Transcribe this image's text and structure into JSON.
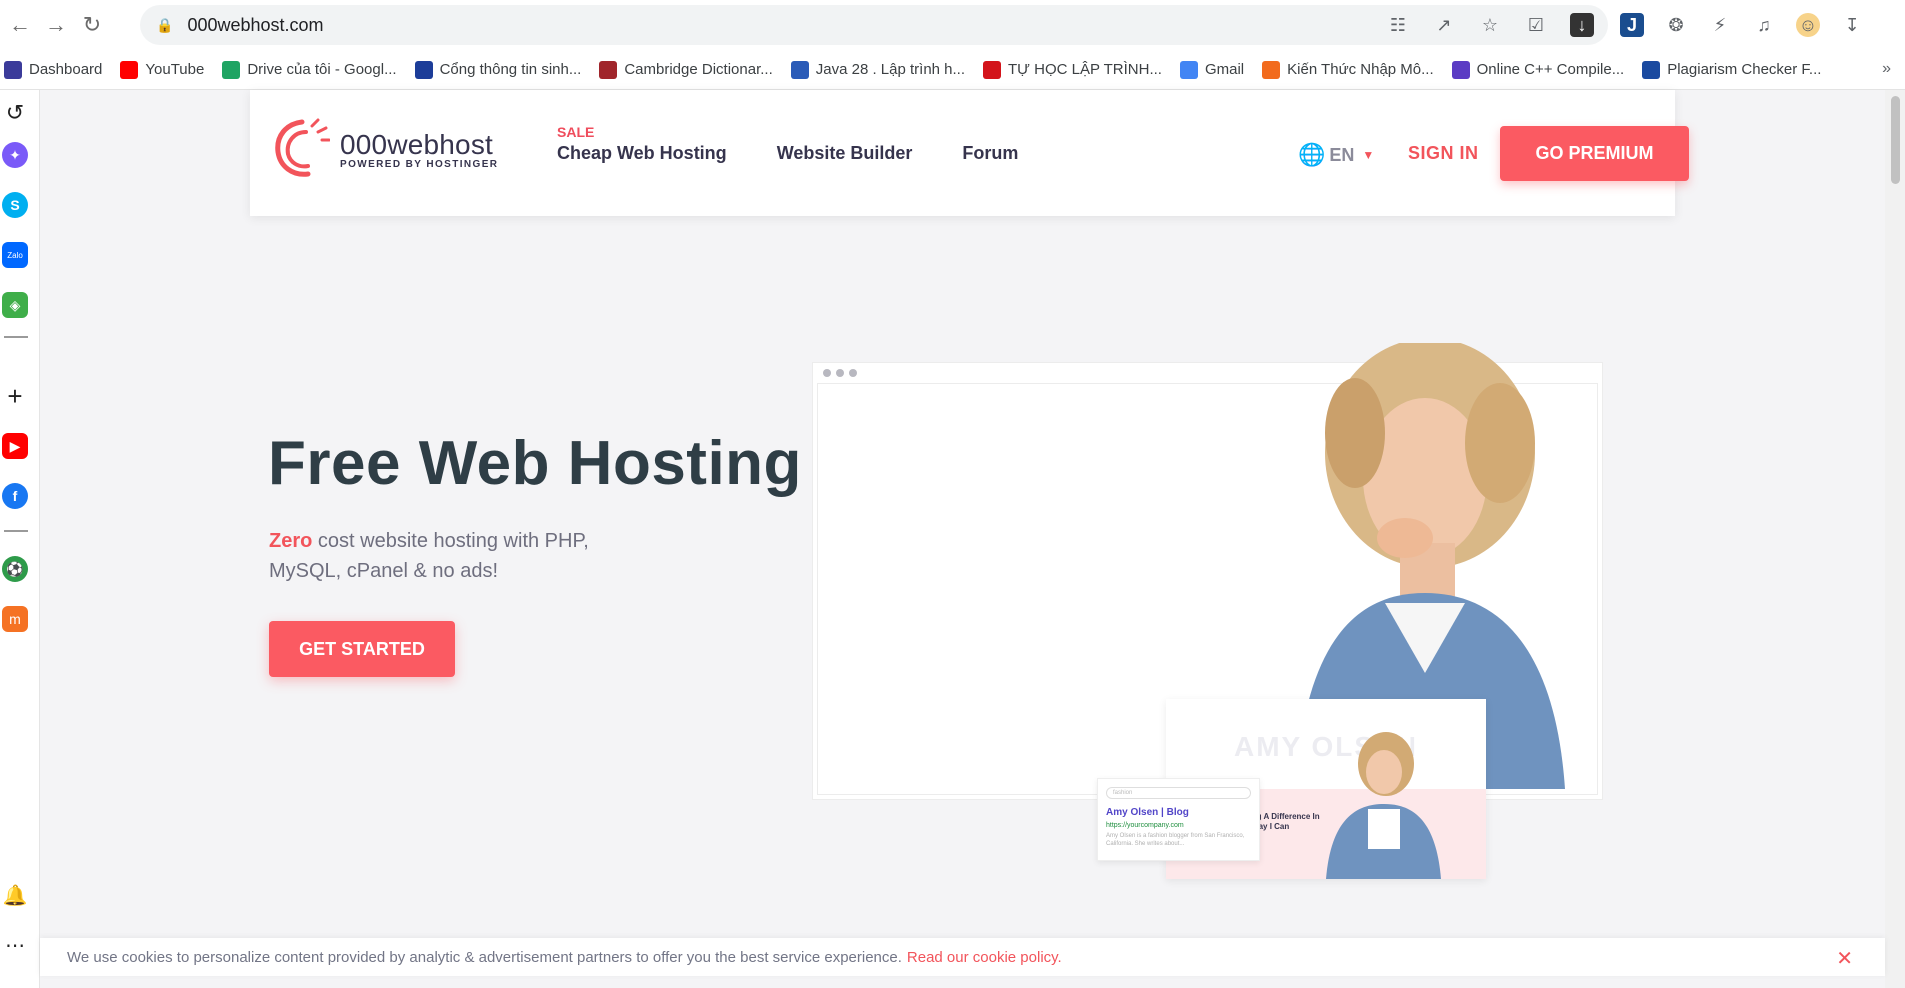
{
  "browser": {
    "url": "000webhost.com",
    "bookmarks": [
      {
        "label": "Dashboard",
        "color": "#3b3b9a"
      },
      {
        "label": "YouTube",
        "color": "#ff0000"
      },
      {
        "label": "Drive của tôi - Googl...",
        "color": "#1fa463"
      },
      {
        "label": "Cổng thông tin sinh...",
        "color": "#1c3d99"
      },
      {
        "label": "Cambridge Dictionar...",
        "color": "#a0252b"
      },
      {
        "label": "Java 28 . Lập trình h...",
        "color": "#2a5bb8"
      },
      {
        "label": "TỰ HỌC LẬP TRÌNH...",
        "color": "#d3141b"
      },
      {
        "label": "Gmail",
        "color": "#4285f4"
      },
      {
        "label": "Kiến Thức Nhập Mô...",
        "color": "#f26b1d"
      },
      {
        "label": "Online C++ Compile...",
        "color": "#5b3cc4"
      },
      {
        "label": "Plagiarism Checker F...",
        "color": "#1a4aa0"
      }
    ],
    "bookmarks_more": "»"
  },
  "header": {
    "logo_name": "000webhost",
    "logo_sub": "POWERED BY HOSTINGER",
    "sale_tag": "SALE",
    "nav": [
      "Cheap Web Hosting",
      "Website Builder",
      "Forum"
    ],
    "lang": "EN",
    "sign_in": "SIGN IN",
    "premium": "GO PREMIUM"
  },
  "hero": {
    "title": "Free Web Hosting",
    "sub_highlight": "Zero",
    "sub_rest": " cost website hosting with PHP, MySQL, cPanel & no ads!",
    "cta": "GET STARTED"
  },
  "mockup": {
    "heading": "AMY OLSEN",
    "tagline": "Making A Difference In Any Way I Can",
    "search_placeholder": "fashion",
    "blog_title": "Amy Olsen | Blog",
    "blog_url": "https://yourcompany.com",
    "blog_desc": "Amy Olsen is a fashion blogger from San Francisco, California. She writes about..."
  },
  "cookie": {
    "text": "We use cookies to personalize content provided by analytic & advertisement partners to offer you the best service experience.",
    "link": "Read our cookie policy."
  },
  "colors": {
    "accent": "#fb5a62",
    "text_dark": "#2f3e46"
  }
}
